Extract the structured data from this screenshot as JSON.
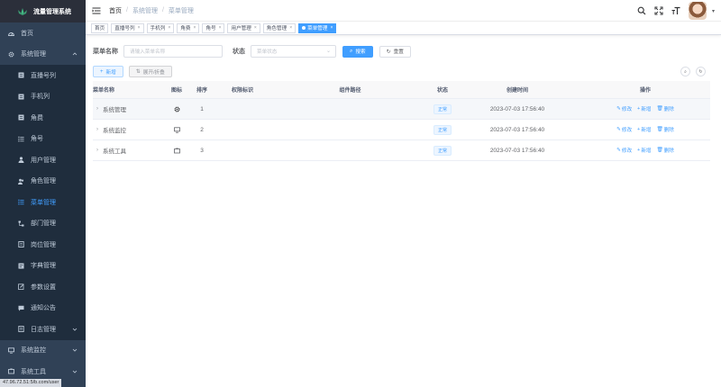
{
  "app": {
    "title": "流量管理系统",
    "status_url": "47.96.72.51:5/b.com/user"
  },
  "sidebar": {
    "items": [
      {
        "label": "首页",
        "icon": "dashboard-icon",
        "type": "top"
      },
      {
        "label": "系统管理",
        "icon": "gear-icon",
        "type": "top-open"
      },
      {
        "label": "直播号列",
        "icon": "list-icon",
        "type": "sub"
      },
      {
        "label": "手机列",
        "icon": "phone-icon",
        "type": "sub"
      },
      {
        "label": "角费",
        "icon": "money-icon",
        "type": "sub"
      },
      {
        "label": "角号",
        "icon": "list-alt-icon",
        "type": "sub"
      },
      {
        "label": "用户管理",
        "icon": "user-icon",
        "type": "sub"
      },
      {
        "label": "角色管理",
        "icon": "peoples-icon",
        "type": "sub"
      },
      {
        "label": "菜单管理",
        "icon": "tree-icon",
        "type": "sub",
        "active": true
      },
      {
        "label": "部门管理",
        "icon": "org-tree-icon",
        "type": "sub"
      },
      {
        "label": "岗位管理",
        "icon": "post-icon",
        "type": "sub"
      },
      {
        "label": "字典管理",
        "icon": "dict-icon",
        "type": "sub"
      },
      {
        "label": "参数设置",
        "icon": "edit-icon",
        "type": "sub"
      },
      {
        "label": "通知公告",
        "icon": "message-icon",
        "type": "sub"
      },
      {
        "label": "日志管理",
        "icon": "log-icon",
        "type": "sub-group"
      },
      {
        "label": "系统监控",
        "icon": "monitor-icon",
        "type": "top-group"
      },
      {
        "label": "系统工具",
        "icon": "tool-icon",
        "type": "top-group"
      }
    ]
  },
  "header": {
    "breadcrumb": [
      "首页",
      "系统管理",
      "菜单管理"
    ]
  },
  "tags": [
    {
      "label": "首页",
      "closable": false
    },
    {
      "label": "直播号列",
      "closable": true
    },
    {
      "label": "手机列",
      "closable": true
    },
    {
      "label": "角费",
      "closable": true
    },
    {
      "label": "角号",
      "closable": true
    },
    {
      "label": "用户管理",
      "closable": true
    },
    {
      "label": "角色管理",
      "closable": true
    },
    {
      "label": "菜单管理",
      "closable": true,
      "active": true
    }
  ],
  "search": {
    "name_label": "菜单名称",
    "name_placeholder": "请输入菜单名称",
    "status_label": "状态",
    "status_placeholder": "菜单状态",
    "search_button": "搜索",
    "reset_button": "重置"
  },
  "toolbar": {
    "add_button": "新增",
    "expand_button": "展开/折叠"
  },
  "table": {
    "columns": [
      "菜单名称",
      "图标",
      "排序",
      "权限标识",
      "组件路径",
      "状态",
      "创建时间",
      "操作"
    ],
    "rows": [
      {
        "name": "系统管理",
        "icon": "gear-icon",
        "order": "1",
        "perm": "",
        "path": "",
        "status": "正常",
        "created": "2023-07-03 17:56:40"
      },
      {
        "name": "系统监控",
        "icon": "monitor-icon",
        "order": "2",
        "perm": "",
        "path": "",
        "status": "正常",
        "created": "2023-07-03 17:56:40"
      },
      {
        "name": "系统工具",
        "icon": "tool-icon",
        "order": "3",
        "perm": "",
        "path": "",
        "status": "正常",
        "created": "2023-07-03 17:56:40"
      }
    ],
    "ops": {
      "edit": "修改",
      "add": "新增",
      "delete": "删除"
    }
  },
  "colors": {
    "primary": "#409eff",
    "sidebar_bg": "#304156",
    "sidebar_sub_bg": "#1f2d3d",
    "sidebar_text": "#bfcbd9"
  }
}
